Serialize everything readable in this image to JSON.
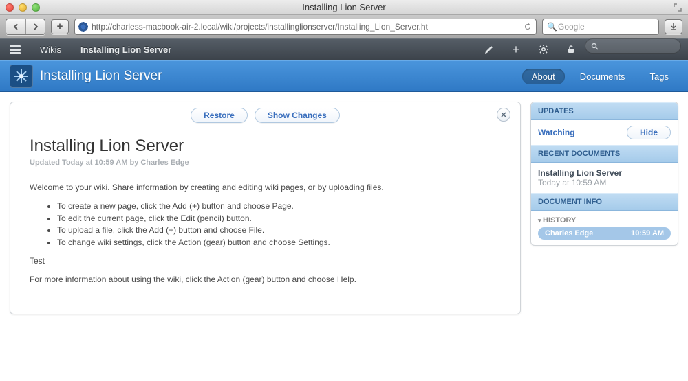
{
  "window": {
    "title": "Installing Lion Server"
  },
  "browser": {
    "url": "http://charless-macbook-air-2.local/wiki/projects/installinglionserver/Installing_Lion_Server.ht",
    "search_placeholder": "Google"
  },
  "wikibar": {
    "wikis_label": "Wikis",
    "crumb_current": "Installing Lion Server"
  },
  "bluehdr": {
    "title": "Installing Lion Server",
    "tabs": {
      "about": "About",
      "documents": "Documents",
      "tags": "Tags"
    }
  },
  "panel": {
    "restore": "Restore",
    "show_changes": "Show Changes",
    "page_title": "Installing Lion Server",
    "updated": "Updated Today at 10:59 AM by Charles Edge",
    "intro": "Welcome to your wiki. Share information by creating and editing wiki pages, or by uploading files.",
    "bullets": [
      "To create a new page, click the Add (+) button and choose Page.",
      "To edit the current page, click the Edit (pencil) button.",
      "To upload a file, click the Add (+) button and choose File.",
      "To change wiki settings, click the Action (gear) button and choose Settings."
    ],
    "test": "Test",
    "more": "For more information about using the wiki, click the Action (gear) button and choose Help."
  },
  "sidebar": {
    "updates_head": "UPDATES",
    "watching": "Watching",
    "hide": "Hide",
    "recent_head": "RECENT DOCUMENTS",
    "recent_title": "Installing Lion Server",
    "recent_time": "Today at 10:59 AM",
    "docinfo_head": "DOCUMENT INFO",
    "history_label": "HISTORY",
    "history_author": "Charles Edge",
    "history_time": "10:59 AM"
  }
}
